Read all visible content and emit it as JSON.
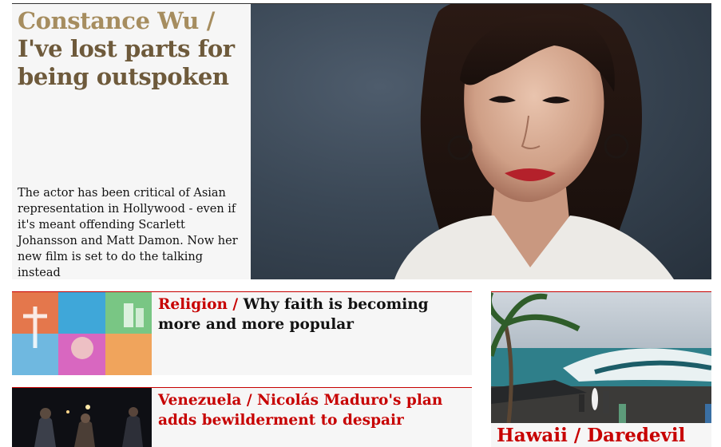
{
  "featured": {
    "kicker": "Constance Wu",
    "separator": " / ",
    "headline": "I've lost parts for being outspoken",
    "standfirst": "The actor has been critical of Asian representation in Hollywood - even if it's meant offending Scarlett Johansson and Matt Damon. Now her new film is set to do the talking instead"
  },
  "cards": {
    "religion": {
      "kicker": "Religion",
      "separator": " / ",
      "headline": "Why faith is becoming more and more popular"
    },
    "venezuela": {
      "kicker": "Venezuela",
      "separator": " / ",
      "headline": "Nicolás Maduro's plan adds bewilderment to despair"
    },
    "hawaii": {
      "kicker": "Hawaii",
      "separator": " / ",
      "headline": "Daredevil"
    }
  },
  "colors": {
    "feature_kicker": "#a68d5f",
    "feature_headline": "#6e5a3b",
    "section_red": "#c70000",
    "card_background": "#f6f6f6"
  }
}
